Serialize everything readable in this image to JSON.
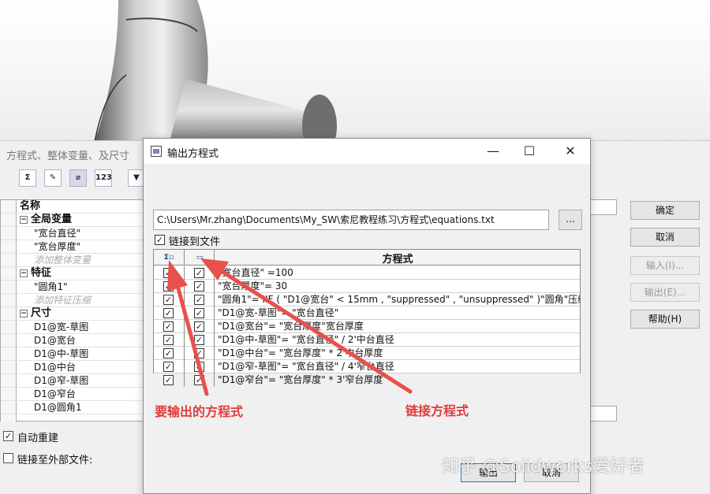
{
  "background": {
    "title": "方程式、整体变量、及尺寸",
    "tree": {
      "header": "名称",
      "groups": [
        {
          "label": "全局变量",
          "items": [
            "\"宽台直径\"",
            "\"宽台厚度\""
          ],
          "add_placeholder": "添加整体变量"
        },
        {
          "label": "特征",
          "items": [
            "\"圆角1\""
          ],
          "add_placeholder": "添加特征压缩"
        },
        {
          "label": "尺寸",
          "items": [
            "D1@宽-草图",
            "D1@宽台",
            "D1@中-草图",
            "D1@中台",
            "D1@窄-草图",
            "D1@窄台",
            "D1@圆角1"
          ]
        }
      ]
    },
    "auto_rebuild_label": "自动重建",
    "link_external_label": "链接至外部文件:",
    "buttons": {
      "ok": "确定",
      "cancel": "取消",
      "import": "输入(I)...",
      "export": "输出(E)...",
      "help": "帮助(H)"
    }
  },
  "dialog": {
    "title": "输出方程式",
    "path": "C:\\Users\\Mr.zhang\\Documents\\My_SW\\索尼教程练习\\方程式\\equations.txt",
    "browse_label": "...",
    "link_to_file_label": "链接到文件",
    "grid_header": "方程式",
    "equations": [
      "\"宽台直径\" =100",
      "\"宽台厚度\"= 30",
      "\"圆角1\"= IIF ( \"D1@宽台\" < 15mm , \"suppressed\" , \"unsuppressed\" )\"圆角\"压缩条件函",
      "\"D1@宽-草图\"= \"宽台直径\"",
      "\"D1@宽台\"= \"宽台厚度\"宽台厚度",
      "\"D1@中-草图\"= \"宽台直径\" / 2'中台直径",
      "\"D1@中台\"= \"宽台厚度\" * 2'中台厚度",
      "\"D1@窄-草图\"= \"宽台直径\" / 4'窄台直径",
      "\"D1@窄台\"= \"宽台厚度\" * 3'窄台厚度"
    ],
    "export_button": "输出",
    "cancel_button": "取消"
  },
  "annotations": {
    "left_label": "要输出的方程式",
    "right_label": "链接方程式",
    "color": "#e03c3c"
  },
  "watermark": "知乎 @Solidworks爱好者"
}
